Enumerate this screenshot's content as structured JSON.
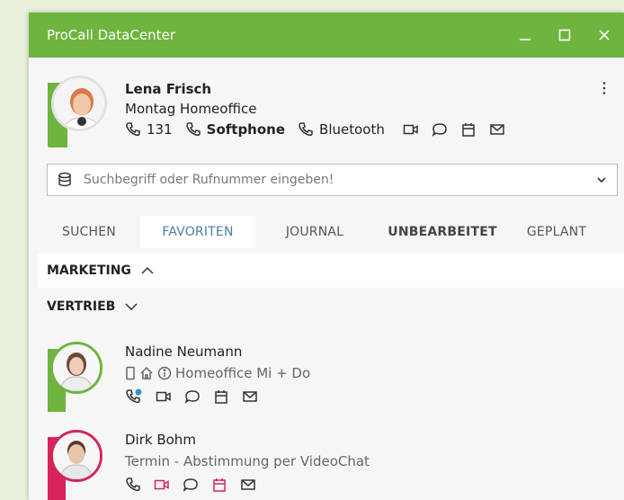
{
  "window": {
    "title": "ProCall DataCenter"
  },
  "colors": {
    "accent_green": "#6eb43f",
    "busy_red": "#d6245a",
    "tab_active_text": "#4a7fa4"
  },
  "profile": {
    "name": "Lena Frisch",
    "status": "Montag Homeoffice",
    "phone_number": "131",
    "device_primary": "Softphone",
    "device_secondary": "Bluetooth"
  },
  "search": {
    "placeholder": "Suchbegriff oder Rufnummer eingeben!"
  },
  "tabs": [
    {
      "label": "SUCHEN"
    },
    {
      "label": "FAVORITEN",
      "active": true
    },
    {
      "label": "JOURNAL"
    },
    {
      "label": "UNBEARBEITET",
      "bold": true
    },
    {
      "label": "GEPLANT"
    }
  ],
  "groups": [
    {
      "label": "MARKETING",
      "expanded": true
    },
    {
      "label": "VERTRIEB",
      "expanded": false
    }
  ],
  "contacts": [
    {
      "name": "Nadine Neumann",
      "status": "Homeoffice Mi + Do",
      "presence": "available"
    },
    {
      "name": "Dirk Bohm",
      "status": "Termin - Abstimmung per VideoChat",
      "presence": "busy"
    }
  ]
}
